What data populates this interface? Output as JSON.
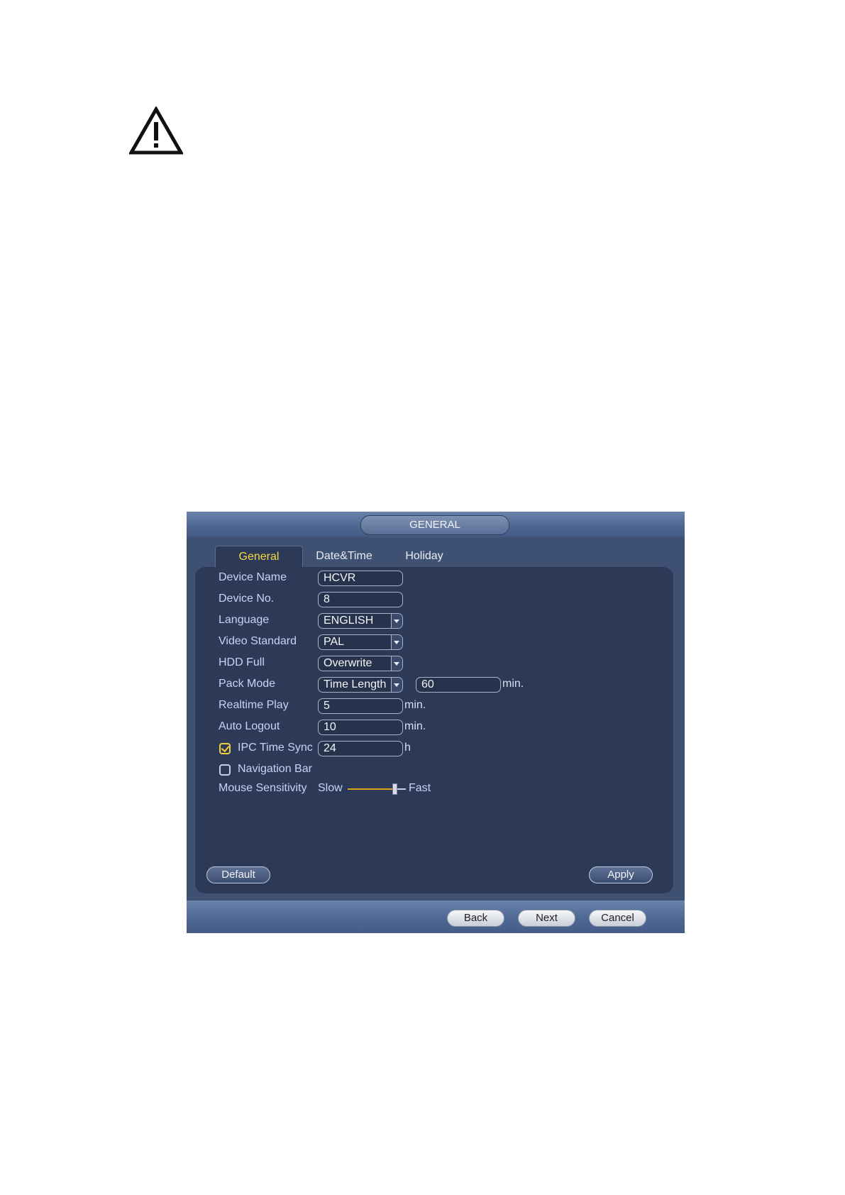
{
  "icons": {
    "warning": "warning-triangle-icon",
    "dropdown": "chevron-down-icon",
    "check": "check-icon"
  },
  "colors": {
    "active_tab": "#f5d742",
    "label": "#c7d3f2",
    "slider": "#e1a21b"
  },
  "window": {
    "title": "GENERAL"
  },
  "tabs": [
    {
      "label": "General",
      "active": true
    },
    {
      "label": "Date&Time",
      "active": false
    },
    {
      "label": "Holiday",
      "active": false
    }
  ],
  "form": {
    "device_name": {
      "label": "Device Name",
      "value": "HCVR"
    },
    "device_no": {
      "label": "Device No.",
      "value": "8"
    },
    "language": {
      "label": "Language",
      "value": "ENGLISH"
    },
    "video_standard": {
      "label": "Video Standard",
      "value": "PAL"
    },
    "hdd_full": {
      "label": "HDD Full",
      "value": "Overwrite"
    },
    "pack_mode": {
      "label": "Pack Mode",
      "value": "Time Length",
      "duration": "60",
      "unit": "min."
    },
    "realtime_play": {
      "label": "Realtime Play",
      "value": "5",
      "unit": "min."
    },
    "auto_logout": {
      "label": "Auto Logout",
      "value": "10",
      "unit": "min."
    },
    "ipc_time_sync": {
      "label": "IPC Time Sync",
      "checked": true,
      "value": "24",
      "unit": "h"
    },
    "navigation_bar": {
      "label": "Navigation Bar",
      "checked": false
    },
    "mouse_sensitivity": {
      "label": "Mouse Sensitivity",
      "slow": "Slow",
      "fast": "Fast",
      "level": 0.8
    }
  },
  "buttons": {
    "default": "Default",
    "apply": "Apply",
    "back": "Back",
    "next": "Next",
    "cancel": "Cancel"
  }
}
